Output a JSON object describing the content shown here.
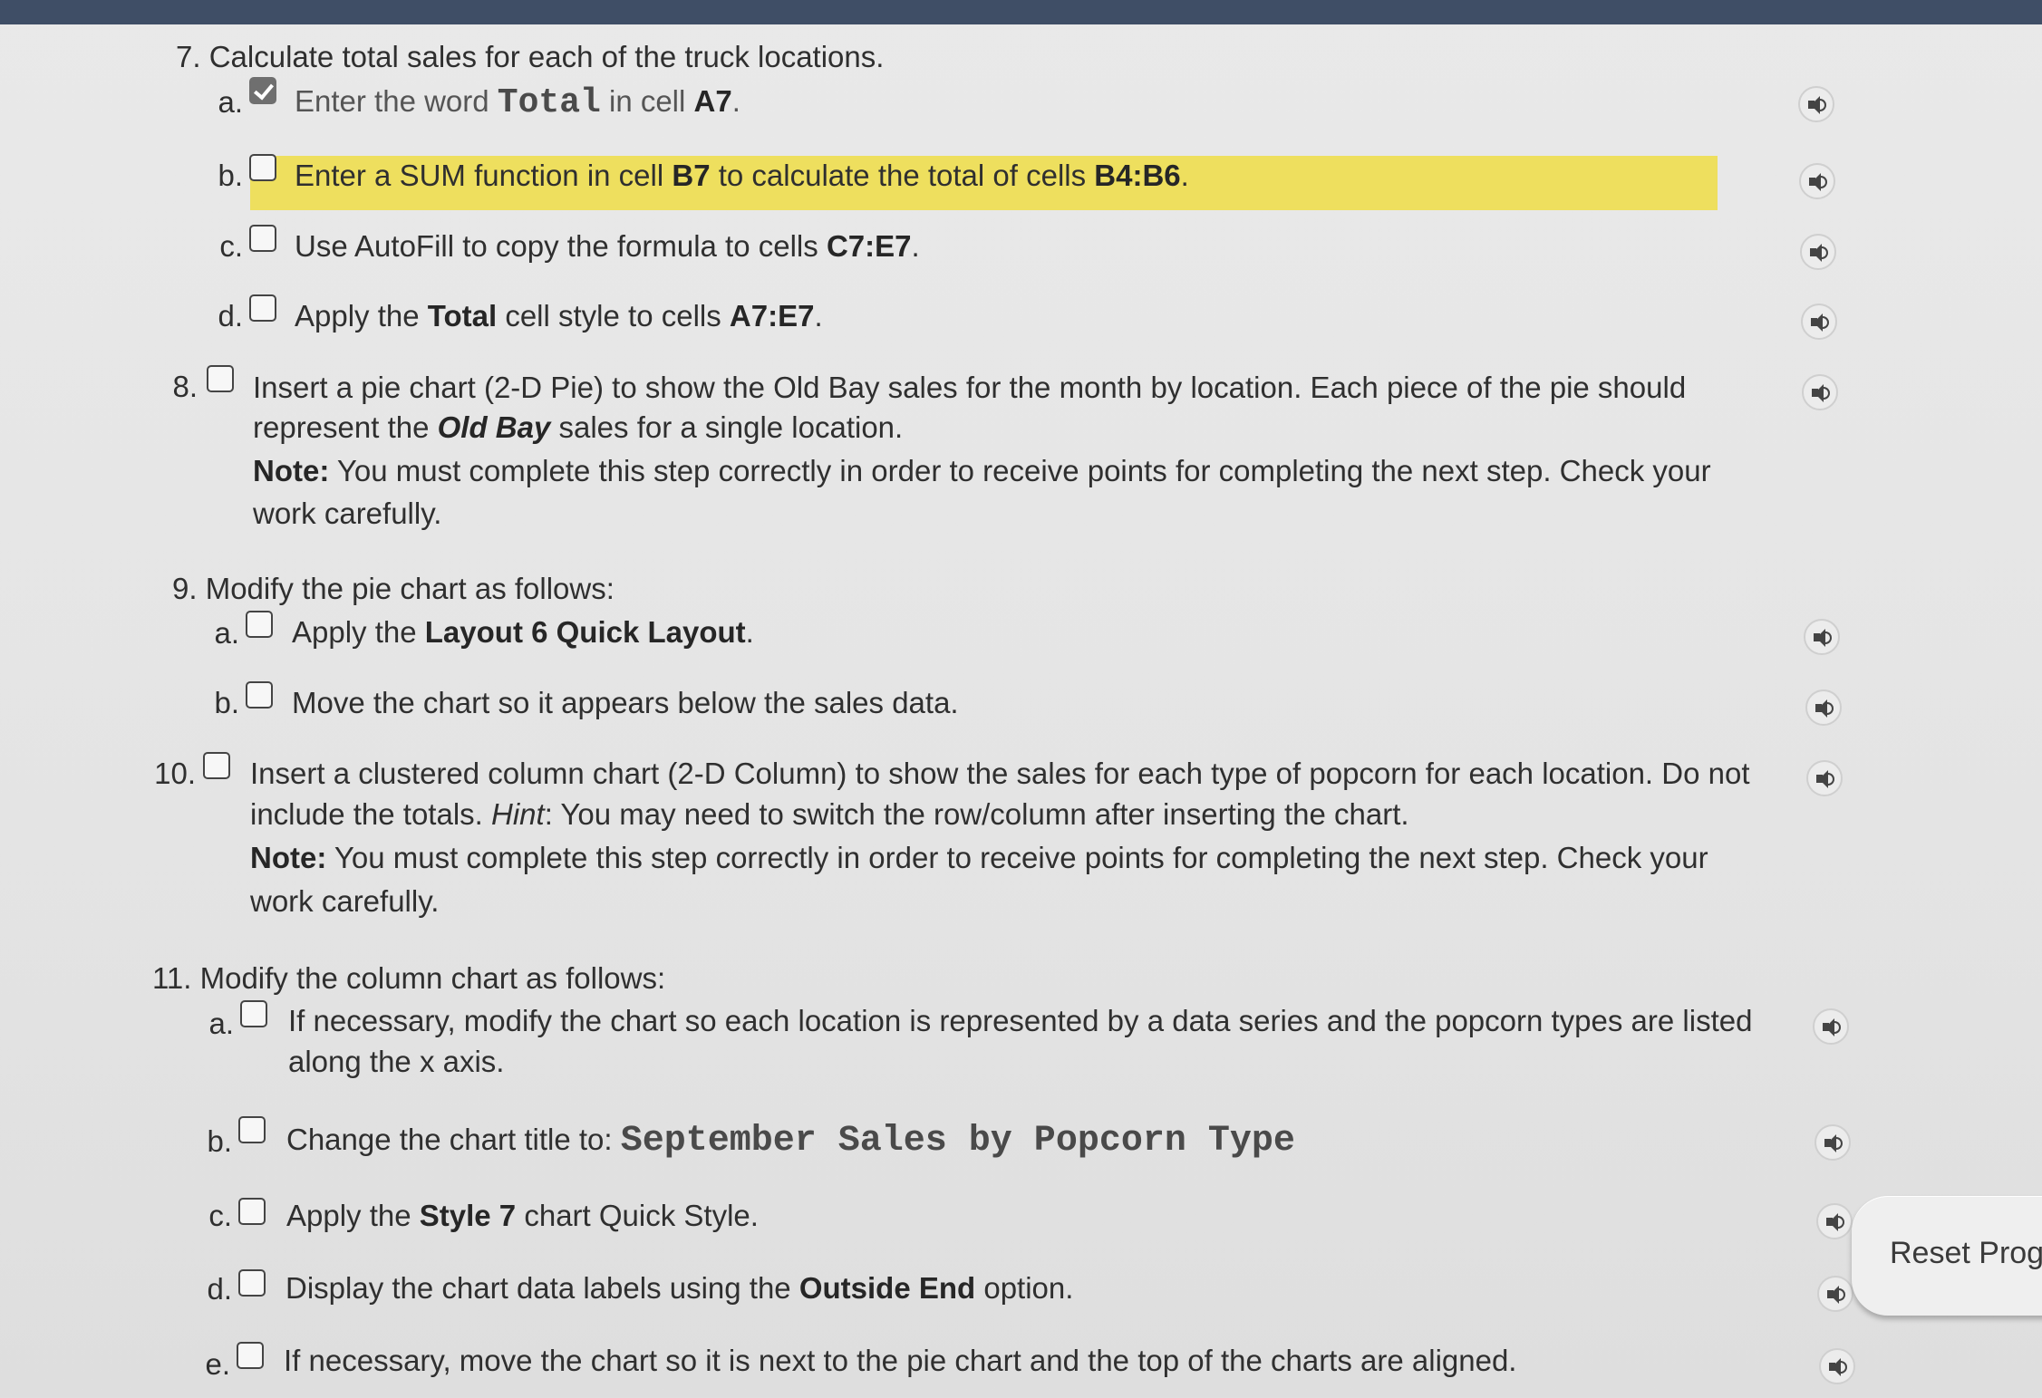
{
  "steps": {
    "s7": {
      "num": "7.",
      "text": "Calculate total sales for each of the truck locations.",
      "a": {
        "label": "a.",
        "pre": "Enter the word ",
        "value": "Total",
        "post": " in cell ",
        "cell": "A7",
        "end": "."
      },
      "b": {
        "label": "b.",
        "pre": "Enter a SUM function in cell ",
        "cell": "B7",
        "mid": " to calculate the total of cells ",
        "range": "B4:B6",
        "end": "."
      },
      "c": {
        "label": "c.",
        "pre": "Use AutoFill to copy the formula to cells ",
        "range": "C7:E7",
        "end": "."
      },
      "d": {
        "label": "d.",
        "pre": "Apply the ",
        "style": "Total",
        "mid": " cell style to cells ",
        "range": "A7:E7",
        "end": "."
      }
    },
    "s8": {
      "num": "8.",
      "line1": "Insert a pie chart (2-D Pie) to show the Old Bay sales for the month by location. Each piece of the pie should",
      "line2_pre": "represent the ",
      "line2_bold": "Old Bay",
      "line2_post": " sales for a single location.",
      "note_label": "Note:",
      "note_text": " You must complete this step correctly in order to receive points for completing the next step. Check your",
      "note_line2": "work carefully."
    },
    "s9": {
      "num": "9.",
      "text": "Modify the pie chart as follows:",
      "a": {
        "label": "a.",
        "pre": "Apply the ",
        "bold": "Layout 6 Quick Layout",
        "end": "."
      },
      "b": {
        "label": "b.",
        "text": "Move the chart so it appears below the sales data."
      }
    },
    "s10": {
      "num": "10.",
      "line1": "Insert a clustered column chart (2-D Column) to show the sales for each type of popcorn for each location. Do not",
      "line2_pre": "include the totals. ",
      "line2_hint": "Hint",
      "line2_post": ": You may need to switch the row/column after inserting the chart.",
      "note_label": "Note:",
      "note_text": " You must complete this step correctly in order to receive points for completing the next step. Check your",
      "note_line2": "work carefully."
    },
    "s11": {
      "num": "11.",
      "text": "Modify the column chart as follows:",
      "a": {
        "label": "a.",
        "line1": "If necessary, modify the chart so each location is represented by a data series and the popcorn types are listed",
        "line2": "along the x axis."
      },
      "b": {
        "label": "b.",
        "pre": "Change the chart title to: ",
        "value": "September Sales by Popcorn Type"
      },
      "c": {
        "label": "c.",
        "pre": "Apply the ",
        "bold": "Style 7",
        "post": " chart Quick Style."
      },
      "d": {
        "label": "d.",
        "pre": "Display the chart data labels using the ",
        "bold": "Outside End",
        "post": " option."
      },
      "e": {
        "label": "e.",
        "text": "If necessary, move the chart so it is next to the pie chart and the top of the charts are aligned."
      }
    }
  },
  "reset_label": "Reset Progr",
  "icons": {
    "audio": "speaker-icon",
    "check": "checkmark-icon"
  },
  "colors": {
    "highlight": "#eedf5e",
    "topbar": "#3f4e66",
    "background": "#e6e6e6"
  }
}
